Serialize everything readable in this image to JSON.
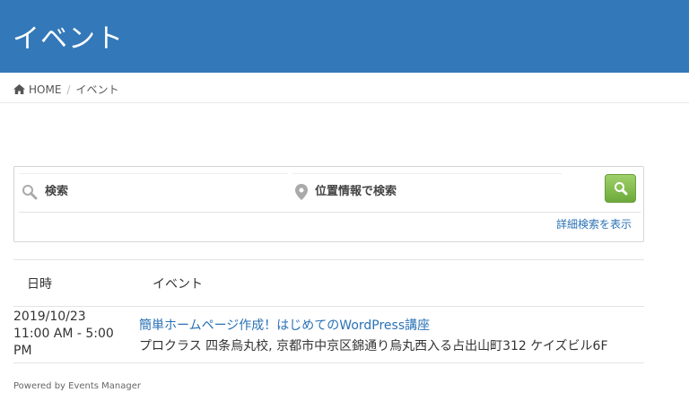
{
  "header": {
    "title": "イベント"
  },
  "breadcrumb": {
    "home": "HOME",
    "separator": "/",
    "current": "イベント"
  },
  "search": {
    "keyword_placeholder": "検索",
    "location_placeholder": "位置情報で検索",
    "advanced_link": "詳細検索を表示",
    "button_icon": "search-icon"
  },
  "table": {
    "headers": {
      "date": "日時",
      "event": "イベント"
    },
    "rows": [
      {
        "date": "2019/10/23",
        "time": "11:00 AM - 5:00 PM",
        "title": "簡単ホームページ作成！はじめてのWordPress講座",
        "location": "プロクラス 四条烏丸校, 京都市中京区錦通り烏丸西入る占出山町312 ケイズビル6F"
      }
    ]
  },
  "footer": {
    "credit": "Powered by Events Manager"
  },
  "colors": {
    "header_bg": "#3378b9",
    "link": "#2a72b5",
    "search_button": "#7cb84a"
  }
}
